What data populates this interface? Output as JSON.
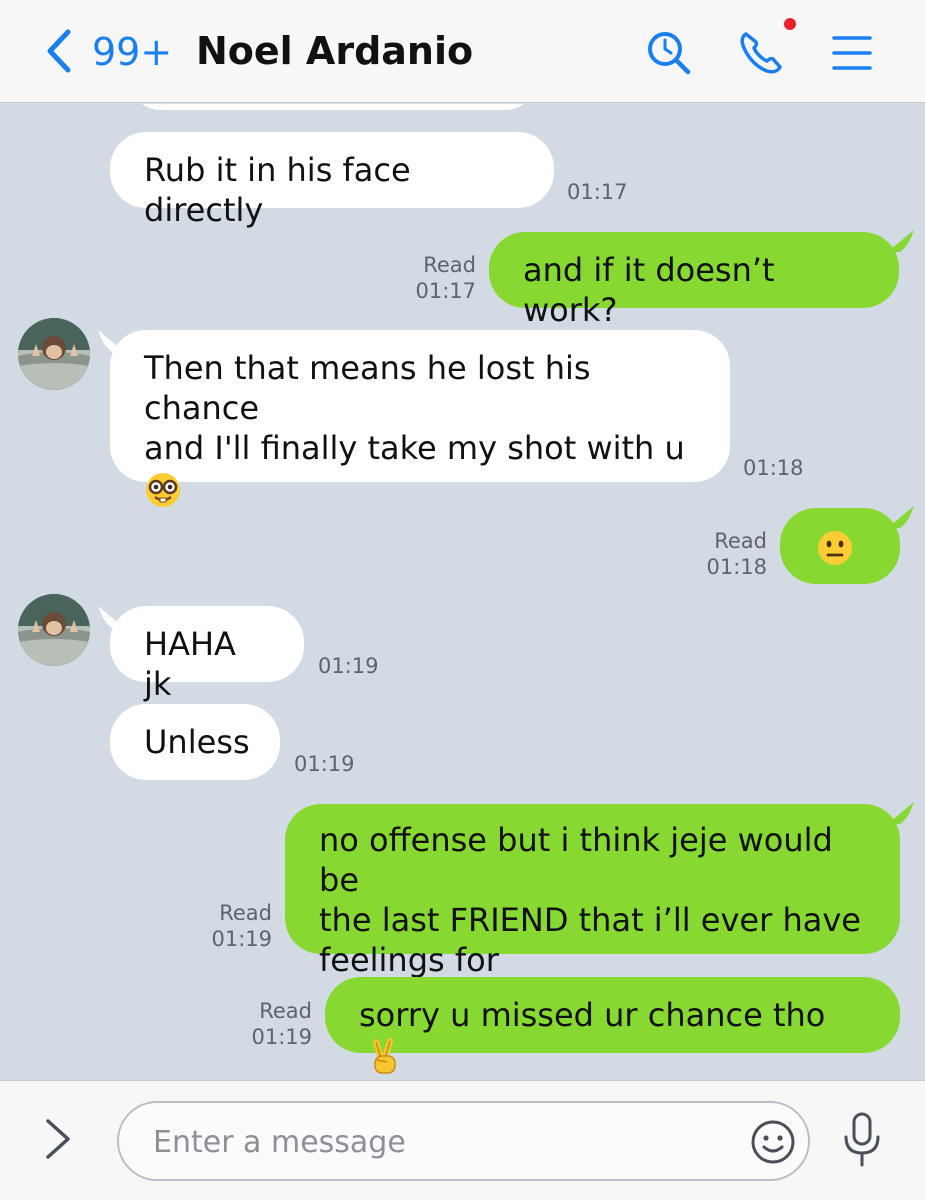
{
  "header": {
    "unread_count": "99+",
    "contact_name": "Noel Ardanio",
    "icons": [
      "back-chevron-icon",
      "search-icon",
      "phone-icon",
      "menu-icon"
    ],
    "accent_color": "#1a7ff0",
    "notification_dot_color": "#e8212f"
  },
  "messages": [
    {
      "side": "in",
      "text": "Rub it in his face directly",
      "time": "01:17"
    },
    {
      "side": "out",
      "text": "and if it doesn’t work?",
      "read": "Read",
      "time": "01:17"
    },
    {
      "side": "in",
      "text_line1": "Then that means he lost his chance",
      "text_line2": "and I'll finally take my shot with u",
      "emoji": "nerd-face-emoji",
      "time": "01:18"
    },
    {
      "side": "out",
      "emoji": "neutral-face-emoji",
      "read": "Read",
      "time": "01:18"
    },
    {
      "side": "in",
      "text": "HAHA jk",
      "time": "01:19"
    },
    {
      "side": "in",
      "text": "Unless",
      "time": "01:19"
    },
    {
      "side": "out",
      "text_line1": "no offense but i think jeje would be",
      "text_line2": "the last FRIEND that i’ll ever have",
      "text_line3": "feelings for",
      "read": "Read",
      "time": "01:19"
    },
    {
      "side": "out",
      "text": "sorry u missed ur chance tho",
      "emoji": "victory-hand-emoji",
      "read": "Read",
      "time": "01:19"
    }
  ],
  "colors": {
    "incoming_bubble": "#ffffff",
    "outgoing_bubble": "#87d831",
    "chat_background": "#d2dae4"
  },
  "input": {
    "placeholder": "Enter a message",
    "value": ""
  }
}
